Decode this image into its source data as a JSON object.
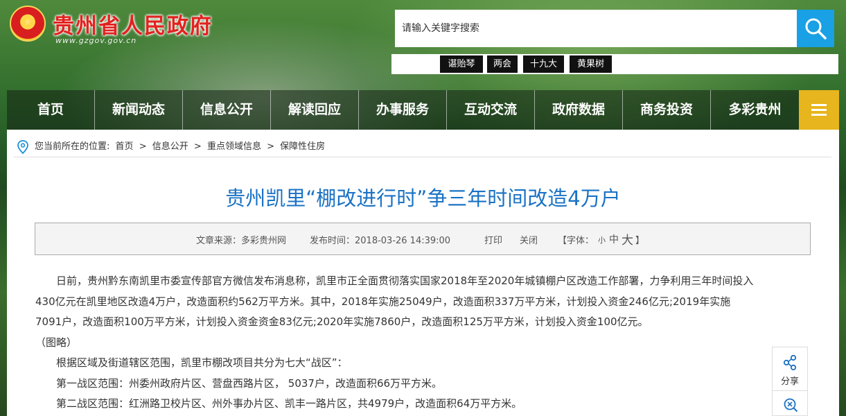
{
  "header": {
    "emblem_glyph": "★",
    "site_title": "贵州省人民政府",
    "site_url": "www.gzgov.gov.cn",
    "search_placeholder": "请输入关键字搜索",
    "hot_tags": [
      "谌贻琴",
      "两会",
      "十九大",
      "黄果树"
    ]
  },
  "nav": {
    "items": [
      "首页",
      "新闻动态",
      "信息公开",
      "解读回应",
      "办事服务",
      "互动交流",
      "政府数据",
      "商务投资",
      "多彩贵州"
    ],
    "menu_icon": "hamburger-icon"
  },
  "breadcrumb": {
    "prefix": "您当前所在的位置:",
    "items": [
      "首页",
      "信息公开",
      "重点领域信息",
      "保障性住房"
    ],
    "separator": ">"
  },
  "article": {
    "title": "贵州凯里“棚改进行时”争三年时间改造4万户",
    "source": "文章来源：多彩贵州网",
    "publish_time": "发布时间：2018-03-26 14:39:00",
    "print_label": "打印",
    "close_label": "关闭",
    "font_label_open": "【字体：",
    "font_small": "小",
    "font_medium": "中",
    "font_large": "大",
    "font_label_close": "】",
    "paragraphs": [
      "日前，贵州黔东南凯里市委宣传部官方微信发布消息称，凯里市正全面贯彻落实国家2018年至2020年城镇棚户区改造工作部署，力争利用三年时间投入430亿元在凯里地区改造4万户，改造面积约562万平方米。其中，2018年实施25049户，改造面积337万平方米，计划投入资金246亿元;2019年实施7091户，改造面积100万平方米，计划投入资金资金83亿元;2020年实施7860户，改造面积125万平方米，计划投入资金100亿元。",
      "（图略）",
      "根据区域及街道辖区范围，凯里市棚改项目共分为七大“战区”：",
      "第一战区范围：州委州政府片区、营盘西路片区， 5037户，改造面积66万平方米。",
      "第二战区范围：红洲路卫校片区、州外事办片区、凯丰一路片区，共4979户，改造面积64万平方米。"
    ]
  },
  "share": {
    "label": "分享",
    "icon": "share-icon",
    "zoom_icon": "zoom-icon"
  },
  "colors": {
    "title_blue": "#1a72c5",
    "search_blue": "#1aa0e4",
    "menu_gold": "#e7b51d",
    "site_title_red": "#e2221f"
  }
}
